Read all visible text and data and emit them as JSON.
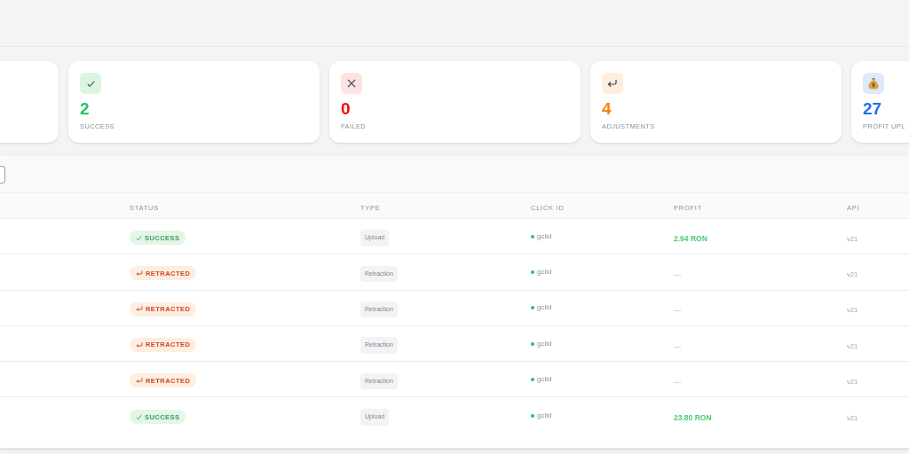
{
  "stat_cards": [
    {
      "kind": "success",
      "value": "2",
      "label": "SUCCESS"
    },
    {
      "kind": "failed",
      "value": "0",
      "label": "FAILED"
    },
    {
      "kind": "adjustments",
      "value": "4",
      "label": "ADJUSTMENTS"
    },
    {
      "kind": "profit",
      "value": "27",
      "label": "PROFIT UPL"
    }
  ],
  "table": {
    "columns": [
      "STATUS",
      "TYPE",
      "CLICK ID",
      "PROFIT",
      "API"
    ],
    "rows": [
      {
        "status": {
          "kind": "success",
          "label": "SUCCESS"
        },
        "type": "Upload",
        "click_id": "gclid",
        "profit": "2.94 RON",
        "api": "v21"
      },
      {
        "status": {
          "kind": "retracted",
          "label": "RETRACTED"
        },
        "type": "Retraction",
        "click_id": "gclid",
        "profit": "—",
        "api": "v21"
      },
      {
        "status": {
          "kind": "retracted",
          "label": "RETRACTED"
        },
        "type": "Retraction",
        "click_id": "gclid",
        "profit": "—",
        "api": "v21"
      },
      {
        "status": {
          "kind": "retracted",
          "label": "RETRACTED"
        },
        "type": "Retraction",
        "click_id": "gclid",
        "profit": "—",
        "api": "v21"
      },
      {
        "status": {
          "kind": "retracted",
          "label": "RETRACTED"
        },
        "type": "Retraction",
        "click_id": "gclid",
        "profit": "—",
        "api": "v21"
      },
      {
        "status": {
          "kind": "success",
          "label": "SUCCESS"
        },
        "type": "Upload",
        "click_id": "gclid",
        "profit": "23.80 RON",
        "api": "v21"
      }
    ]
  }
}
